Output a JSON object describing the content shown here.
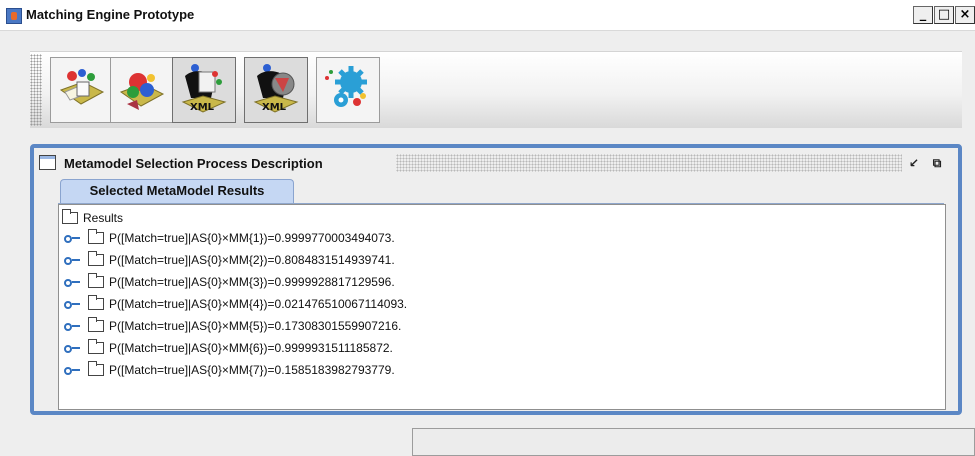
{
  "window": {
    "title": "Matching Engine Prototype",
    "minimize_label": "_",
    "maximize_label": "□",
    "close_label": "×"
  },
  "toolbar": {
    "buttons": [
      {
        "icon": "load-model-icon",
        "pressed": false
      },
      {
        "icon": "load-metamodel-icon",
        "pressed": false
      },
      {
        "icon": "load-xml-model-icon",
        "pressed": true
      },
      {
        "icon": "load-xml-metamodel-icon",
        "pressed": true
      },
      {
        "icon": "settings-gear-icon",
        "pressed": false
      }
    ]
  },
  "panel": {
    "title": "Metamodel Selection Process Description",
    "tab_label": "Selected MetaModel Results",
    "tree": {
      "root_label": "Results",
      "items": [
        "P([Match=true]|AS{0}×MM{1})=0.9999770003494073.",
        "P([Match=true]|AS{0}×MM{2})=0.8084831514939741.",
        "P([Match=true]|AS{0}×MM{3})=0.9999928817129596.",
        "P([Match=true]|AS{0}×MM{4})=0.021476510067114093.",
        "P([Match=true]|AS{0}×MM{5})=0.17308301559907216.",
        "P([Match=true]|AS{0}×MM{6})=0.9999931511185872.",
        "P([Match=true]|AS{0}×MM{7})=0.1585183982793779."
      ]
    }
  },
  "colors": {
    "frame_border": "#5b87c5",
    "tab_bg": "#c5d7f3",
    "tree_handle": "#2f6fbe"
  }
}
